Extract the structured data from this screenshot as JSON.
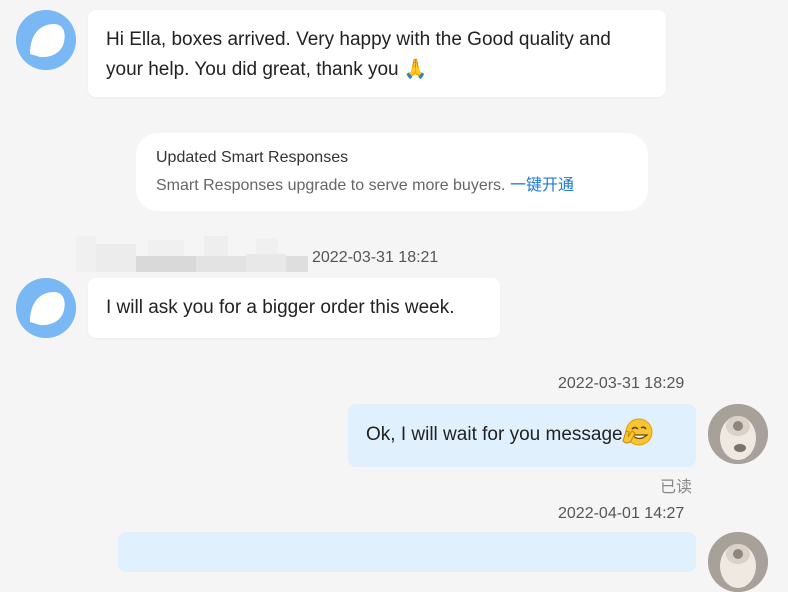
{
  "messages": [
    {
      "text": "Hi Ella, boxes arrived. Very happy with the Good quality and your help. You did great, thank you 🙏"
    },
    {
      "timestamp": "2022-03-31 18:21",
      "text": "I will ask you for a bigger order this week."
    }
  ],
  "notice": {
    "title": "Updated Smart Responses",
    "body": "Smart Responses upgrade to serve more buyers.",
    "link": "一键开通"
  },
  "my_messages": [
    {
      "timestamp": "2022-03-31 18:29",
      "text": "Ok, I will wait for you message",
      "emoji": "grinning-v-sign-icon",
      "status": "已读"
    },
    {
      "timestamp": "2022-04-01 14:27"
    }
  ]
}
